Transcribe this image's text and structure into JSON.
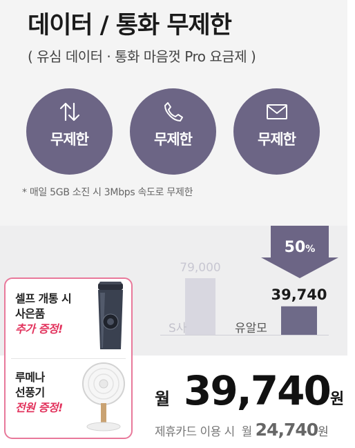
{
  "plan": {
    "title": "데이터 / 통화 무제한",
    "subtitle": "( 유심 데이터 · 통화 마음껏 Pro 요금제 )",
    "benefits": [
      {
        "icon": "data-arrows-icon",
        "label": "무제한"
      },
      {
        "icon": "phone-icon",
        "label": "무제한"
      },
      {
        "icon": "envelope-icon",
        "label": "무제한"
      }
    ],
    "footnote": "* 매일 5GB 소진 시 3Mbps 속도로 무제한",
    "circle_color": "#6c6585"
  },
  "chart_data": {
    "type": "bar",
    "categories": [
      "S사",
      "유알모"
    ],
    "values": [
      79000,
      39740
    ],
    "data_labels": [
      "79,000",
      "39,740"
    ],
    "colors": [
      "#d8d7e0",
      "#6e6a88"
    ],
    "badge": {
      "text": "50",
      "unit": "%",
      "color": "#6c6585"
    },
    "ylim": [
      0,
      79000
    ],
    "grid": false
  },
  "gifts": [
    {
      "line1": "셀프 개통 시",
      "line2": "사은품",
      "accent": "추가 증정!",
      "image": "tumbler-image"
    },
    {
      "line1": "루메나",
      "line2": "선풍기",
      "accent": "전원 증정!",
      "image": "fan-image"
    }
  ],
  "price": {
    "month_label": "월",
    "amount": "39,740",
    "currency": "원",
    "card_label": "제휴카드 이용 시",
    "card_month": "월",
    "card_amount": "24,740",
    "card_currency": "원"
  }
}
